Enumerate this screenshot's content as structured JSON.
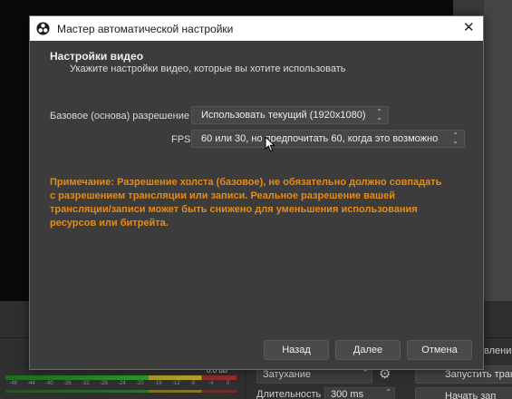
{
  "dialog": {
    "title": "Мастер автоматической настройки",
    "section_title": "Настройки видео",
    "section_subtitle": "Укажите настройки видео, которые вы хотите использовать",
    "base_resolution_label": "Базовое (основа) разрешение",
    "base_resolution_value": "Использовать текущий (1920x1080)",
    "fps_label": "FPS",
    "fps_value": "60 или 30, но предпочитать 60, когда это возможно",
    "note_lines": [
      "Примечание: Разрешение холста (базовое), не обязательно должно совпадать",
      "с разрешением трансляции или записи. Реальное разрешение вашей",
      "трансляции/записи может быть снижено для уменьшения использования",
      "ресурсов или битрейта."
    ],
    "back_label": "Назад",
    "next_label": "Далее",
    "cancel_label": "Отмена",
    "note_color": "#e88a14"
  },
  "background": {
    "db_label": "0.0 dB",
    "meter_ticks": [
      "-48",
      "-44",
      "-40",
      "-36",
      "-32",
      "-28",
      "-24",
      "-20",
      "-16",
      "-12",
      "-8",
      "-4",
      "0"
    ],
    "fade_label": "Затухание",
    "duration_label": "Длительность",
    "duration_value": "300 ms",
    "start_stream_label": "Запустить тран",
    "start_record_label": "Начать зап",
    "right_panel_text": "вления"
  },
  "icons": {
    "app_icon": "obs-logo-icon",
    "close_icon": "close-icon",
    "combo_icon": "updown-chevron-icon",
    "gear_icon": "gear-icon",
    "cursor": "mouse-pointer-icon"
  }
}
